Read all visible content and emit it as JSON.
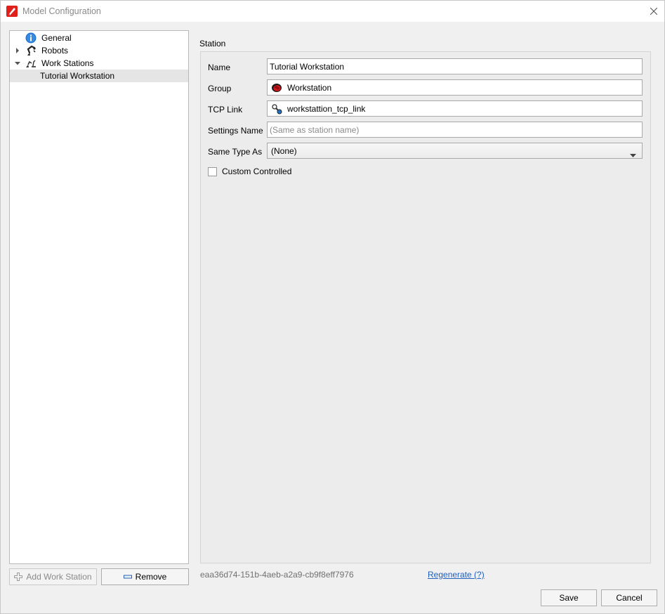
{
  "window": {
    "title": "Model Configuration"
  },
  "tree": {
    "items": [
      {
        "label": "General",
        "icon": "info-icon",
        "expander": "none"
      },
      {
        "label": "Robots",
        "icon": "robot-arm-icon",
        "expander": "collapsed"
      },
      {
        "label": "Work Stations",
        "icon": "workstation-icon",
        "expander": "expanded"
      },
      {
        "label": "Tutorial Workstation",
        "icon": "none",
        "expander": "none",
        "selected": true
      }
    ]
  },
  "left_buttons": {
    "add_label": "Add Work Station",
    "remove_label": "Remove"
  },
  "station": {
    "section_title": "Station",
    "name_label": "Name",
    "name_value": "Tutorial Workstation",
    "group_label": "Group",
    "group_value": "Workstation",
    "tcp_label": "TCP Link",
    "tcp_value": "workstattion_tcp_link",
    "settings_label": "Settings Name",
    "settings_placeholder": "(Same as station name)",
    "same_type_label": "Same Type As",
    "same_type_value": "(None)",
    "custom_controlled_label": "Custom Controlled",
    "custom_controlled_checked": false
  },
  "footer": {
    "guid": "eaa36d74-151b-4aeb-a2a9-cb9f8eff7976",
    "regenerate_label": "Regenerate (?)",
    "save_label": "Save",
    "cancel_label": "Cancel"
  },
  "colors": {
    "app_icon_red": "#e0201b",
    "info_blue": "#1e73d2",
    "link_blue": "#1f5fbf",
    "group_red": "#d0161b"
  }
}
